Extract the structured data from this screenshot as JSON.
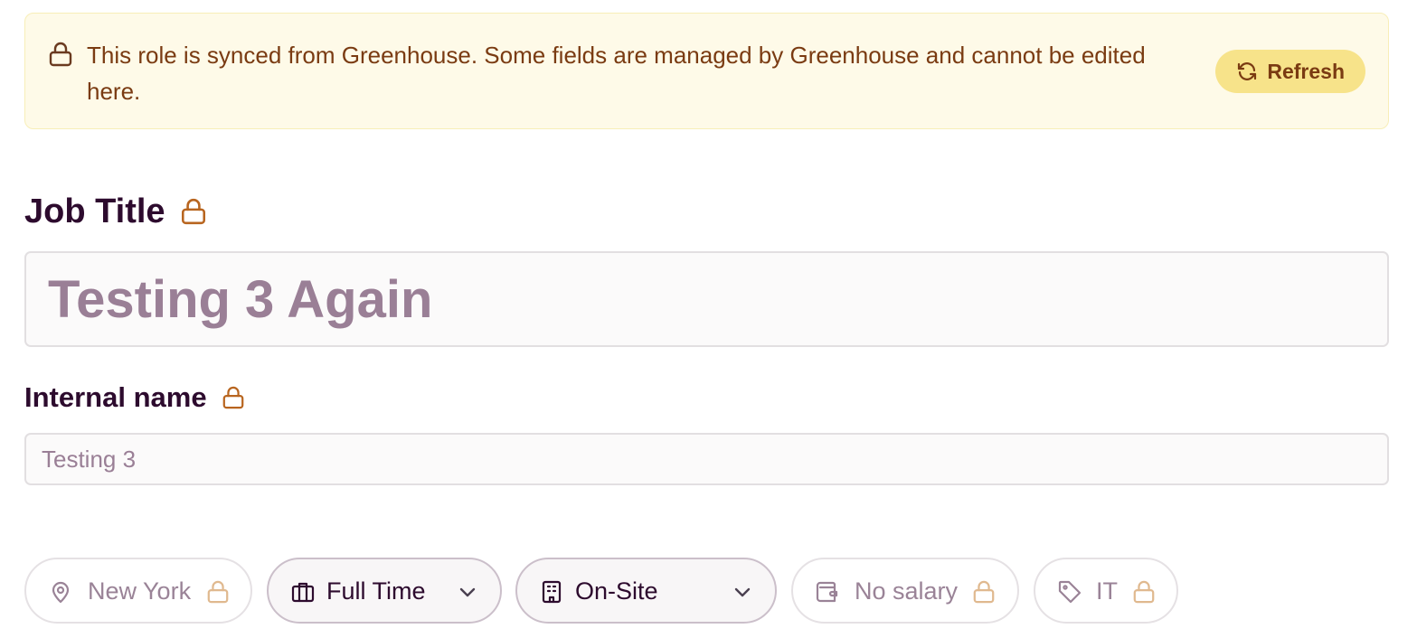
{
  "banner": {
    "message": "This role is synced from Greenhouse. Some fields are managed by Greenhouse and cannot be edited here.",
    "refresh_label": "Refresh"
  },
  "job_title": {
    "label": "Job Title",
    "value": "Testing 3 Again",
    "locked": true
  },
  "internal_name": {
    "label": "Internal name",
    "value": "Testing 3",
    "locked": true
  },
  "chips": {
    "location": {
      "label": "New York",
      "icon": "map-pin-icon",
      "locked": true
    },
    "employment_type": {
      "label": "Full Time",
      "icon": "briefcase-icon",
      "dropdown": true
    },
    "workplace": {
      "label": "On-Site",
      "icon": "building-icon",
      "dropdown": true
    },
    "salary": {
      "label": "No salary",
      "icon": "wallet-icon",
      "locked": true
    },
    "department": {
      "label": "IT",
      "icon": "tag-icon",
      "locked": true
    }
  },
  "colors": {
    "banner_bg": "#fefae8",
    "banner_text": "#7a3b12",
    "refresh_bg": "#f7e38a",
    "lock_accent": "#b8651f",
    "heading": "#2d0b2e",
    "muted_text": "#9a7f96"
  }
}
